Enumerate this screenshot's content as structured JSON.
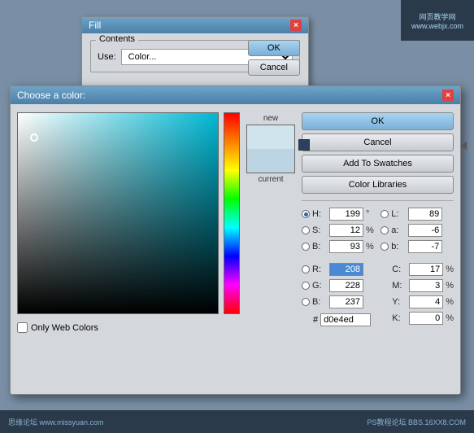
{
  "watermark": {
    "top_line1": "网页教学网",
    "top_line2": "www.webjx.com",
    "bottom_left": "思缘论坛  www.missyuan.com",
    "bottom_right": "PS教程论坛  BBS.16XX8.COM"
  },
  "fill_dialog": {
    "title": "Fill",
    "close": "×",
    "group_label": "Contents",
    "use_label": "Use:",
    "use_value": "Color...",
    "ok_label": "OK",
    "cancel_label": "Cancel"
  },
  "color_dialog": {
    "title": "Choose a color:",
    "close": "×",
    "ok_label": "OK",
    "cancel_label": "Cancel",
    "add_swatches_label": "Add To Swatches",
    "color_libraries_label": "Color Libraries",
    "new_label": "new",
    "current_label": "current",
    "only_web_colors_label": "Only Web Colors",
    "h_label": "H:",
    "h_value": "199",
    "h_unit": "°",
    "s_label": "S:",
    "s_value": "12",
    "s_unit": "%",
    "b_label": "B:",
    "b_value": "93",
    "b_unit": "%",
    "r_label": "R:",
    "r_value": "208",
    "g_label": "G:",
    "g_value": "228",
    "b2_label": "B:",
    "b2_value": "237",
    "l_label": "L:",
    "l_value": "89",
    "a_label": "a:",
    "a_value": "-6",
    "b3_label": "b:",
    "b3_value": "-7",
    "c_label": "C:",
    "c_value": "17",
    "c_unit": "%",
    "m_label": "M:",
    "m_value": "3",
    "m_unit": "%",
    "y_label": "Y:",
    "y_value": "4",
    "y_unit": "%",
    "k_label": "K:",
    "k_value": "0",
    "k_unit": "%",
    "hex_label": "#",
    "hex_value": "d0e4ed"
  }
}
